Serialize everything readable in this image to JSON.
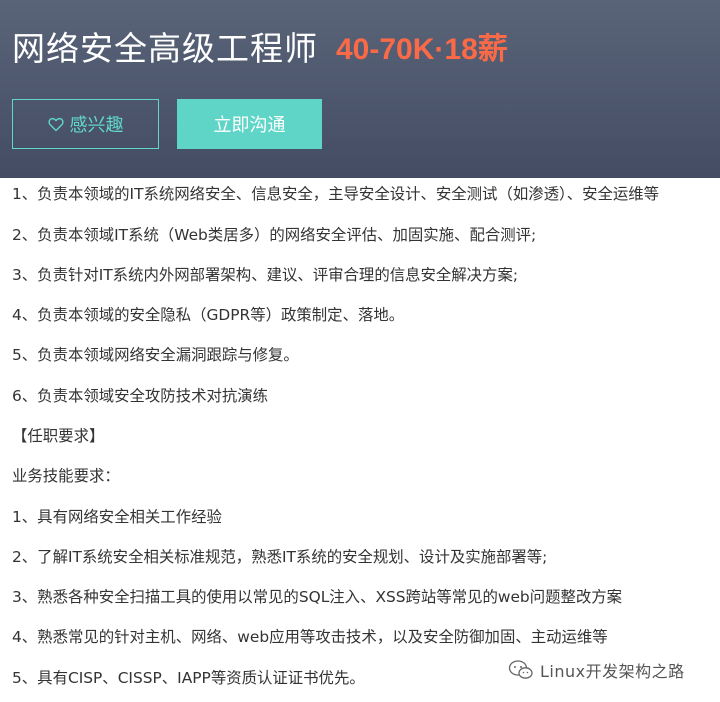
{
  "header": {
    "title": "网络安全高级工程师",
    "salary": "40-70K·18薪",
    "interested_button": "感兴趣",
    "chat_button": "立即沟通"
  },
  "description": {
    "lines": [
      "1、负责本领域的IT系统网络安全、信息安全，主导安全设计、安全测试（如渗透）、安全运维等",
      "2、负责本领域IT系统（Web类居多）的网络安全评估、加固实施、配合测评;",
      "3、负责针对IT系统内外网部署架构、建议、评审合理的信息安全解决方案;",
      "4、负责本领域的安全隐私（GDPR等）政策制定、落地。",
      "5、负责本领域网络安全漏洞跟踪与修复。",
      "6、负责本领域安全攻防技术对抗演练",
      "【任职要求】",
      "业务技能要求：",
      "1、具有网络安全相关工作经验",
      "2、了解IT系统安全相关标准规范，熟悉IT系统的安全规划、设计及实施部署等;",
      "3、熟悉各种安全扫描工具的使用以常见的SQL注入、XSS跨站等常见的web问题整改方案",
      "4、熟悉常见的针对主机、网络、web应用等攻击技术，以及安全防御加固、主动运维等",
      "5、具有CISP、CISSP、IAPP等资质认证证书优先。"
    ]
  },
  "watermark": {
    "text": "Linux开发架构之路",
    "icon": "wechat-icon"
  },
  "colors": {
    "header_bg": "#4b546b",
    "accent_teal": "#5ed5c6",
    "salary_orange": "#fa6a47",
    "body_text": "#333333"
  }
}
